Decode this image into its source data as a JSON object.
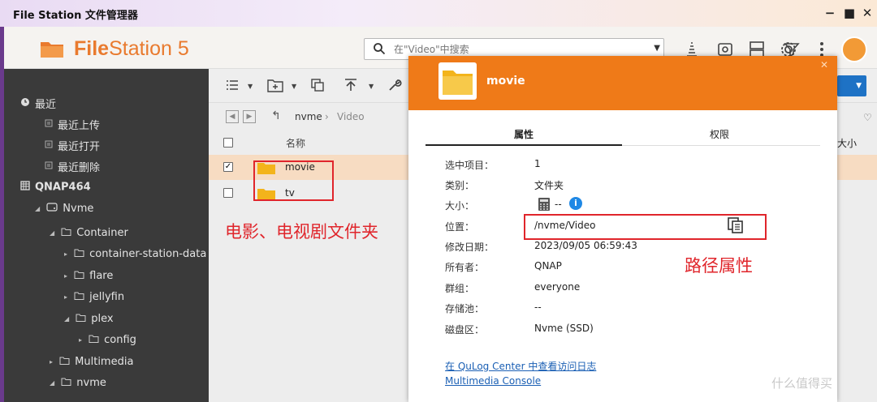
{
  "window": {
    "title": "File Station 文件管理器",
    "controls": [
      "minimize",
      "maximize",
      "close"
    ]
  },
  "app": {
    "logo_prefix": "File",
    "logo_suffix": "Station 5",
    "search_placeholder": "在\"Video\"中搜索",
    "accent_color": "#e97a2e"
  },
  "sidebar": {
    "sections": {
      "recent": "最近",
      "nas": "QNAP464"
    },
    "recent_items": [
      "最近上传",
      "最近打开",
      "最近删除"
    ],
    "tree": [
      {
        "label": "Nvme",
        "level": 0
      },
      {
        "label": "Container",
        "level": 1
      },
      {
        "label": "container-station-data",
        "level": 2
      },
      {
        "label": "flare",
        "level": 2
      },
      {
        "label": "jellyfin",
        "level": 2
      },
      {
        "label": "plex",
        "level": 2
      },
      {
        "label": "config",
        "level": 3
      },
      {
        "label": "Multimedia",
        "level": 1
      },
      {
        "label": "nvme",
        "level": 1
      }
    ]
  },
  "main": {
    "breadcrumb": [
      "nvme",
      "Video"
    ],
    "column_name": "名称",
    "column_size": "大小",
    "files": [
      {
        "name": "movie",
        "selected": true
      },
      {
        "name": "tv",
        "selected": false
      }
    ],
    "annotation_folders": "电影、电视剧文件夹"
  },
  "dialog": {
    "title": "movie",
    "tabs": [
      "属性",
      "权限"
    ],
    "active_tab": "属性",
    "properties": [
      {
        "label": "选中项目：",
        "value": "1"
      },
      {
        "label": "类别：",
        "value": "文件夹"
      },
      {
        "label": "大小：",
        "value": "--"
      },
      {
        "label": "位置：",
        "value": "/nvme/Video"
      },
      {
        "label": "修改日期：",
        "value": "2023/09/05 06:59:43"
      },
      {
        "label": "所有者：",
        "value": "QNAP"
      },
      {
        "label": "群组：",
        "value": "everyone"
      },
      {
        "label": "存储池：",
        "value": "--"
      },
      {
        "label": "磁盘区：",
        "value": "Nvme (SSD)"
      }
    ],
    "links": [
      "在 QuLog Center 中查看访问日志",
      "Multimedia Console"
    ],
    "annotation_path": "路径属性",
    "header_color": "#ef7a18"
  },
  "watermark": "什么值得买"
}
